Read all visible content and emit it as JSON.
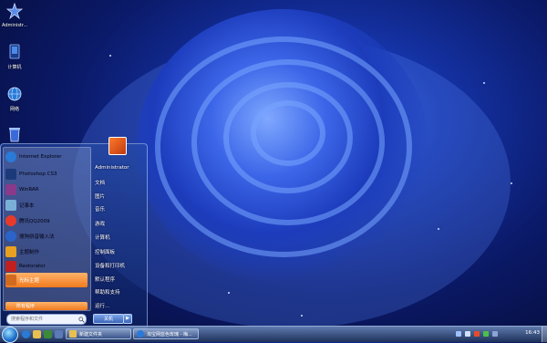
{
  "desktop": {
    "icons": [
      {
        "label": "Administr...",
        "icon": "user-folder-icon"
      },
      {
        "label": "计算机",
        "icon": "computer-icon"
      },
      {
        "label": "网络",
        "icon": "network-icon"
      },
      {
        "label": "",
        "icon": "recycle-bin-icon"
      }
    ]
  },
  "start_menu": {
    "programs": [
      {
        "label": "Internet Explorer",
        "icon": "internet-explorer-icon",
        "color": "#2a7ad8"
      },
      {
        "label": "Photoshop CS3",
        "icon": "photoshop-icon",
        "color": "#1c3a7a"
      },
      {
        "label": "WinRAR",
        "icon": "winrar-icon",
        "color": "#8a3a8a"
      },
      {
        "label": "记事本",
        "icon": "notepad-icon",
        "color": "#7ab0d8"
      },
      {
        "label": "腾讯QQ2009",
        "icon": "qq-icon",
        "color": "#e83a2a"
      },
      {
        "label": "搜狗拼音输入法",
        "icon": "sogou-icon",
        "color": "#2a64c8"
      },
      {
        "label": "主题制作",
        "icon": "theme-maker-icon",
        "color": "#e8a020"
      },
      {
        "label": "Restorator",
        "icon": "restorator-icon",
        "color": "#c02020"
      },
      {
        "label": "光标主题",
        "icon": "cursor-theme-icon",
        "color": "#d06a20"
      }
    ],
    "all_programs_label": "所有程序",
    "search_placeholder": "搜索程序和文件",
    "right_items": [
      "Administrator",
      "文档",
      "图片",
      "音乐",
      "游戏",
      "计算机",
      "控制面板",
      "设备和打印机",
      "默认程序",
      "帮助和支持",
      "运行..."
    ],
    "shutdown_label": "关机",
    "shutdown_arrow": "▶"
  },
  "taskbar": {
    "buttons": [
      {
        "label": "新建文件夹",
        "icon": "folder-icon"
      },
      {
        "label": "淘宝网蓝色玫瑰 - 梅...",
        "icon": "browser-icon"
      }
    ],
    "clock": "16:43"
  }
}
